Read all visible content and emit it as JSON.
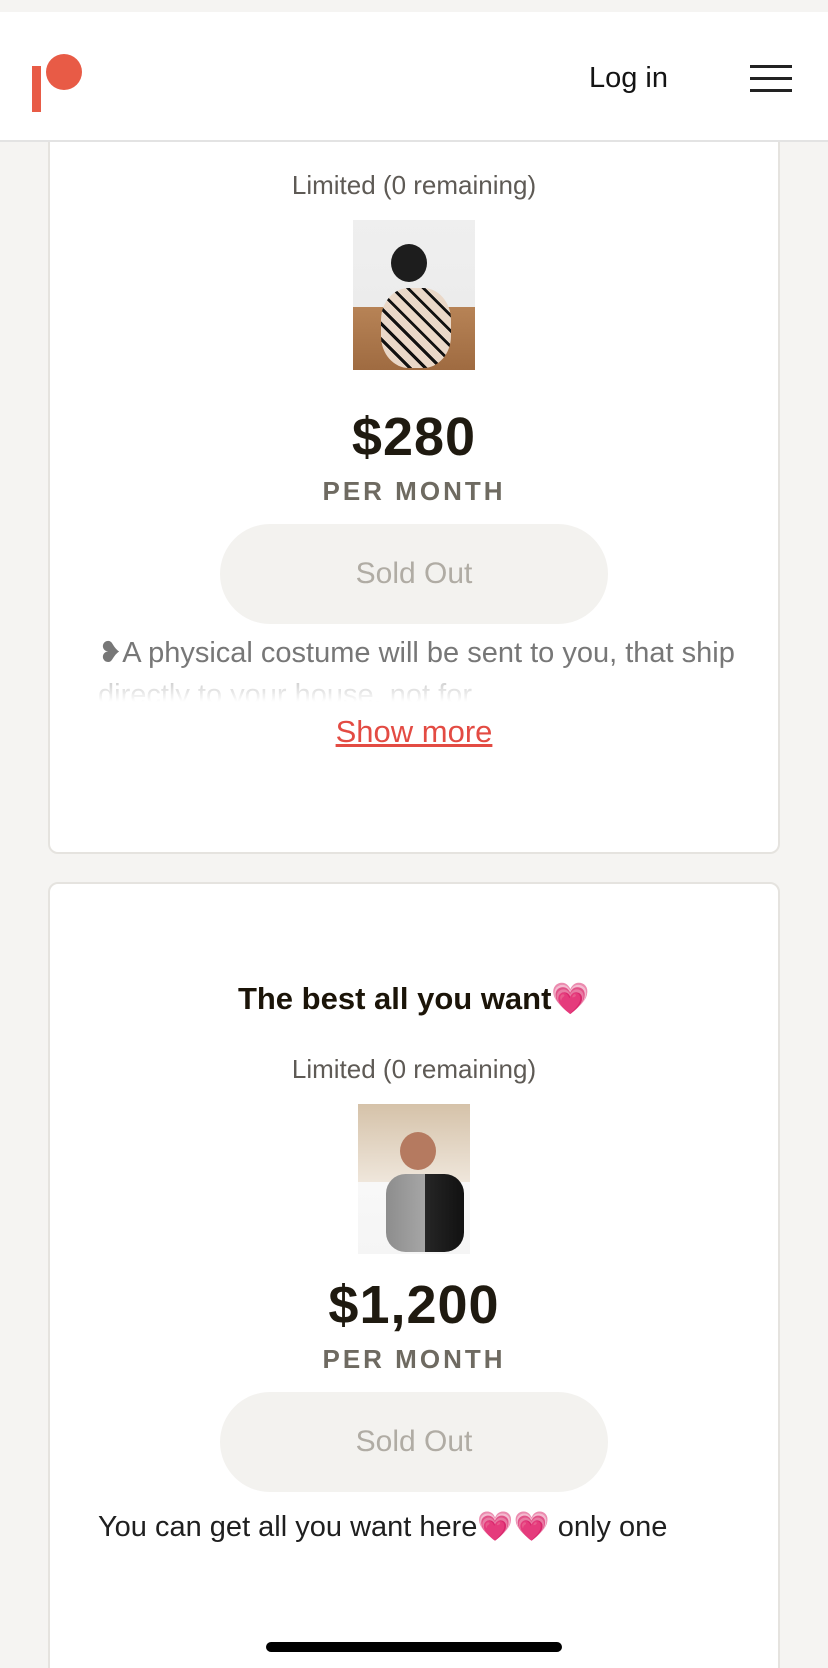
{
  "header": {
    "login_label": "Log in"
  },
  "tiers": [
    {
      "limited_text": "Limited (0 remaining)",
      "price": "$280",
      "period": "PER MONTH",
      "button_label": "Sold Out",
      "description": "❥A physical costume will be sent to you, that ship directly to your house, not for",
      "show_more_label": "Show more"
    },
    {
      "title": "The best all you want💗",
      "limited_text": "Limited (0 remaining)",
      "price": "$1,200",
      "period": "PER MONTH",
      "button_label": "Sold Out",
      "description": "You can get all you want here💗💗 only one"
    }
  ],
  "colors": {
    "brand": "#e85b46",
    "link": "#e34b43",
    "sold_out_bg": "#f3f2ef",
    "sold_out_text": "#b0aca4"
  }
}
